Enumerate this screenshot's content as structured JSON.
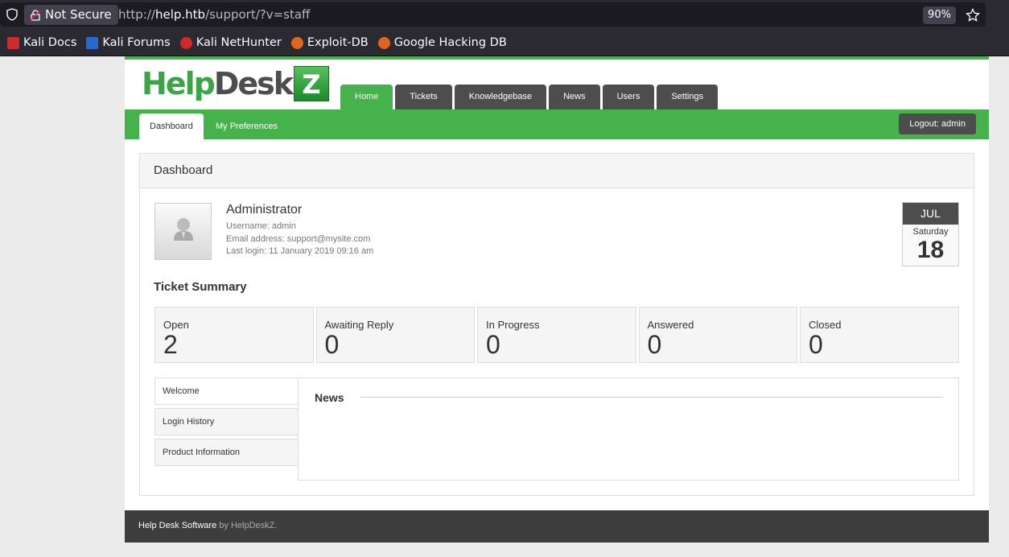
{
  "browser": {
    "security_label": "Not Secure",
    "url_prefix": "http://",
    "url_host": "help.htb",
    "url_path": "/support/?v=staff",
    "zoom": "90%",
    "bookmarks": [
      {
        "label": "Kali Docs",
        "color": "#d02a2a"
      },
      {
        "label": "Kali Forums",
        "color": "#2a6ad0"
      },
      {
        "label": "Kali NetHunter",
        "color": "#d02a2a"
      },
      {
        "label": "Exploit-DB",
        "color": "#e0661f"
      },
      {
        "label": "Google Hacking DB",
        "color": "#e0661f"
      }
    ]
  },
  "site": {
    "logo": {
      "help": "Help",
      "desk": "Desk",
      "z": "Z"
    },
    "main_tabs": [
      "Home",
      "Tickets",
      "Knowledgebase",
      "News",
      "Users",
      "Settings"
    ],
    "sub_tabs": [
      "Dashboard",
      "My Preferences"
    ],
    "logout": "Logout: admin"
  },
  "dashboard": {
    "title": "Dashboard",
    "profile": {
      "name": "Administrator",
      "username": "Username: admin",
      "email": "Email address: support@mysite.com",
      "last_login": "Last login: 11 January 2019 09:16 am"
    },
    "calendar": {
      "month": "JUL",
      "weekday": "Saturday",
      "day": "18"
    },
    "ticket_summary": {
      "title": "Ticket Summary",
      "items": [
        {
          "label": "Open",
          "value": "2"
        },
        {
          "label": "Awaiting Reply",
          "value": "0"
        },
        {
          "label": "In Progress",
          "value": "0"
        },
        {
          "label": "Answered",
          "value": "0"
        },
        {
          "label": "Closed",
          "value": "0"
        }
      ]
    },
    "side_tabs": [
      "Welcome",
      "Login History",
      "Product Information"
    ],
    "news_title": "News"
  },
  "footer": {
    "brand": "Help Desk Software",
    "suffix": " by HelpDeskZ."
  },
  "colors": {
    "accent": "#46b24c",
    "dark": "#4d4d4d"
  }
}
